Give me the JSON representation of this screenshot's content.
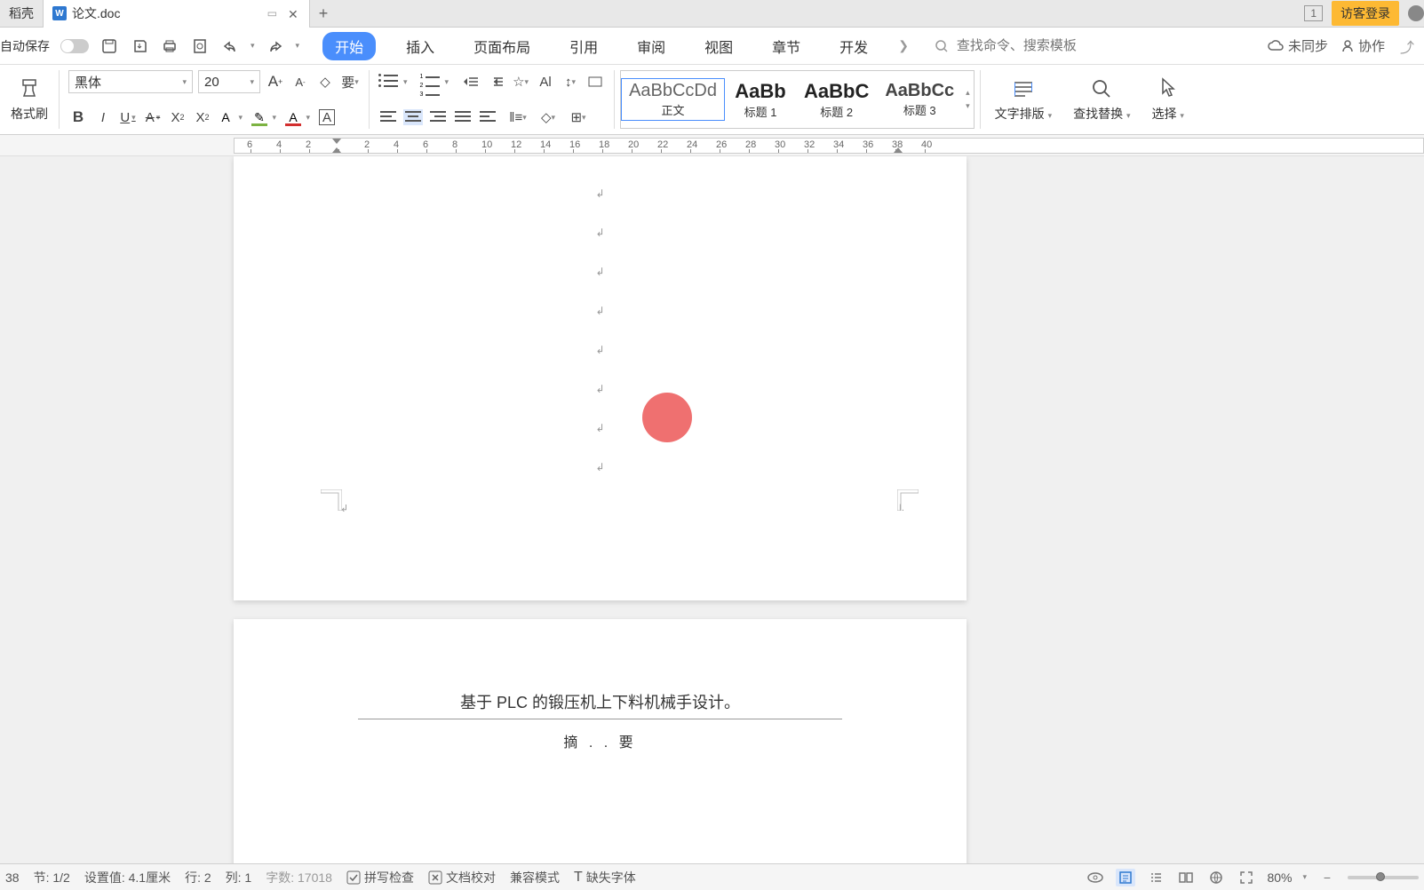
{
  "titleBar": {
    "tab1": "稻壳",
    "tab2": "论文.doc",
    "badgeNum": "1",
    "login": "访客登录"
  },
  "qa": {
    "autosave": "自动保存",
    "menu": {
      "start": "开始",
      "insert": "插入",
      "layout": "页面布局",
      "reference": "引用",
      "review": "审阅",
      "view": "视图",
      "chapter": "章节",
      "develop": "开发"
    },
    "searchPlaceholder": "查找命令、搜索模板",
    "notSynced": "未同步",
    "collab": "协作"
  },
  "ribbon": {
    "formatBrush": "格式刷",
    "fontName": "黑体",
    "fontSize": "20",
    "styles": {
      "normal": "正文",
      "h1": "标题 1",
      "h2": "标题 2",
      "h3": "标题 3",
      "preview1": "AaBbCcDd",
      "preview2": "AaBb",
      "preview3": "AaBbC",
      "preview4": "AaBbCc"
    },
    "textLayout": "文字排版",
    "findReplace": "查找替换",
    "select": "选择"
  },
  "ruler": {
    "marks": [
      "6",
      "4",
      "2",
      "",
      "2",
      "4",
      "6",
      "8",
      "10",
      "12",
      "14",
      "16",
      "18",
      "20",
      "22",
      "24",
      "26",
      "28",
      "30",
      "32",
      "34",
      "36",
      "38",
      "40"
    ]
  },
  "document": {
    "headerTitle": "基于 PLC 的锻压机上下料机械手设计。",
    "abstract": "摘 . . 要"
  },
  "status": {
    "page": "38",
    "section": "节: 1/2",
    "setting": "设置值: 4.1厘米",
    "row": "行: 2",
    "col": "列: 1",
    "wordCount": "字数: 17018",
    "spellCheck": "拼写检查",
    "docCheck": "文档校对",
    "compat": "兼容模式",
    "missingFont": "缺失字体",
    "zoom": "80%"
  }
}
